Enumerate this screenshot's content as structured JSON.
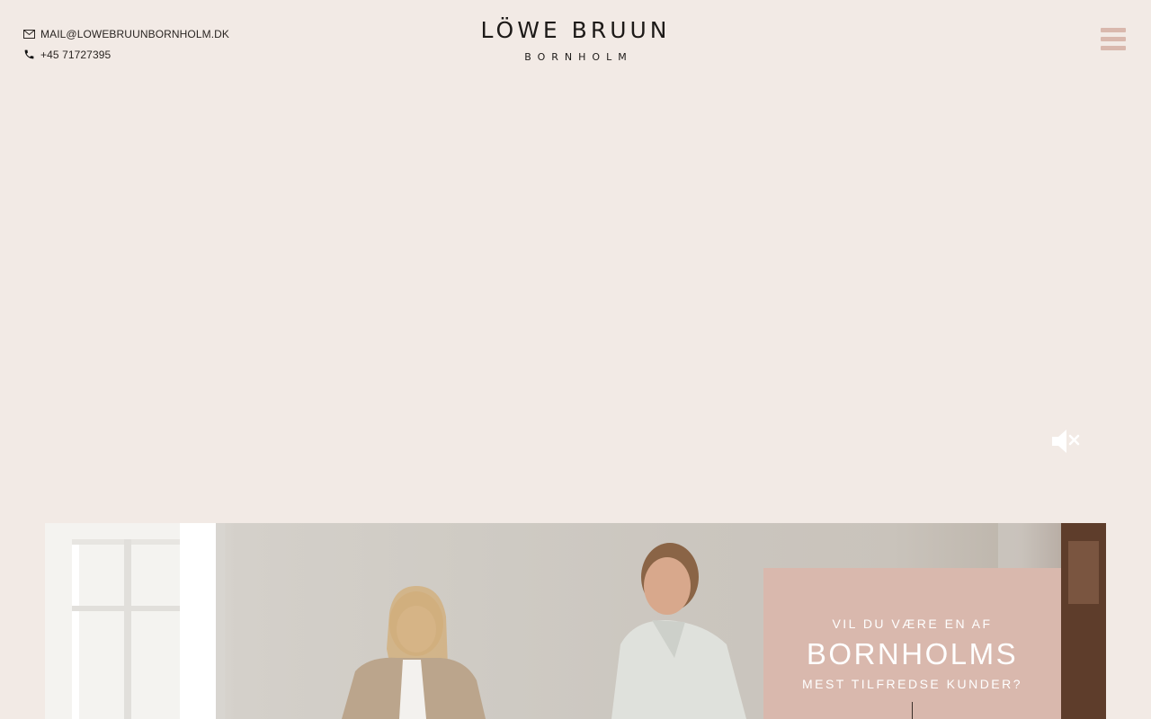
{
  "header": {
    "email": "MAIL@LOWEBRUUNBORNHOLM.DK",
    "phone": "+45 71727395",
    "logo_main": "LÖWE BRUUN",
    "logo_sub": "BORNHOLM",
    "email_icon": "envelope-icon",
    "phone_icon": "phone-icon",
    "menu_icon": "hamburger-icon"
  },
  "video": {
    "mute_icon": "speaker-muted-icon"
  },
  "cta": {
    "line1": "VIL DU VÆRE EN AF",
    "line2": "BORNHOLMS",
    "line3": "MEST TILFREDSE KUNDER?"
  },
  "colors": {
    "background": "#f2eae5",
    "accent": "#d9b8ad",
    "text": "#1d1a18"
  }
}
